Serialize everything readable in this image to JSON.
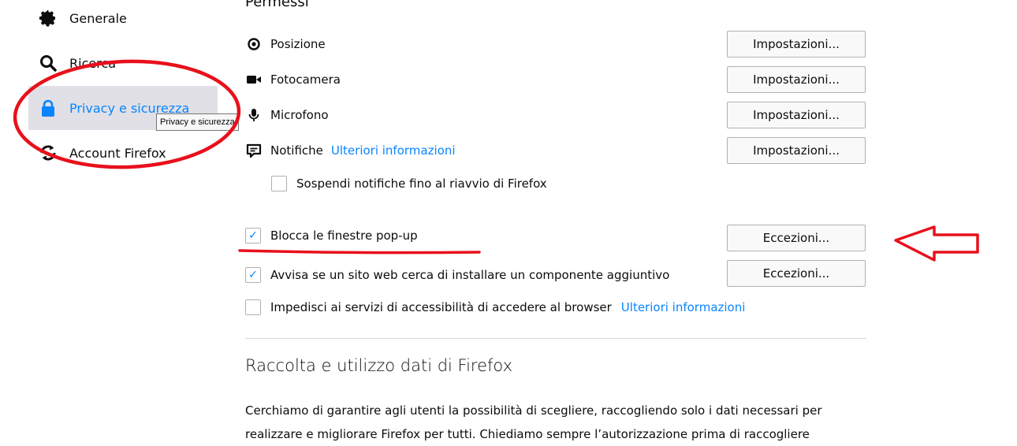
{
  "sidebar": {
    "items": [
      {
        "label": "Generale",
        "icon": "gear-icon"
      },
      {
        "label": "Ricerca",
        "icon": "search-icon"
      },
      {
        "label": "Privacy e sicurezza",
        "icon": "lock-icon"
      },
      {
        "label": "Account Firefox",
        "icon": "sync-icon"
      }
    ],
    "tooltip": "Privacy e sicurezza"
  },
  "permissions": {
    "heading_partial": "Permessi",
    "rows": [
      {
        "label": "Posizione",
        "icon": "location-icon",
        "button": "Impostazioni..."
      },
      {
        "label": "Fotocamera",
        "icon": "camera-icon",
        "button": "Impostazioni..."
      },
      {
        "label": "Microfono",
        "icon": "microphone-icon",
        "button": "Impostazioni..."
      },
      {
        "label": "Notifiche",
        "icon": "notification-icon",
        "link": "Ulteriori informazioni",
        "button": "Impostazioni..."
      }
    ],
    "pause_notifications": "Sospendi notifiche fino al riavvio di Firefox",
    "block_popups": "Blocca le finestre pop-up",
    "block_popups_button": "Eccezioni...",
    "warn_addons": "Avvisa se un sito web cerca di installare un componente aggiuntivo",
    "warn_addons_button": "Eccezioni...",
    "accessibility": "Impedisci ai servizi di accessibilità di accedere al browser",
    "accessibility_link": "Ulteriori informazioni"
  },
  "data_collection": {
    "title": "Raccolta e utilizzo dati di Firefox",
    "line1": "Cerchiamo di garantire agli utenti la possibilità di scegliere, raccogliendo solo i dati necessari per",
    "line2": "realizzare e migliorare Firefox per tutti. Chiediamo sempre l’autorizzazione prima di raccogliere"
  },
  "colors": {
    "accent": "#0a84ff",
    "annotation": "#e8101c",
    "selected_bg": "#e0e0e6"
  }
}
